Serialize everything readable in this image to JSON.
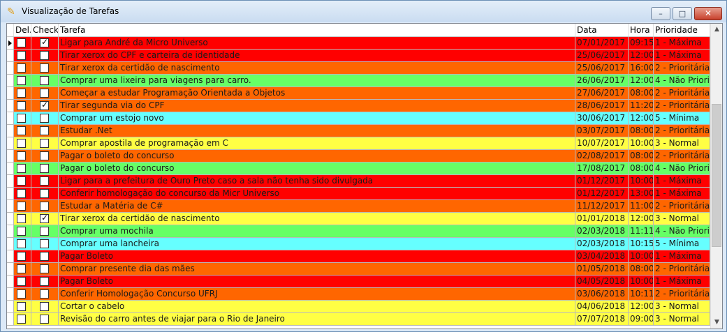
{
  "window": {
    "title": "Visualização de Tarefas",
    "app_icon": "app-icon",
    "buttons": {
      "minimize": "–",
      "maximize": "□",
      "close": "✕"
    }
  },
  "grid": {
    "columns": {
      "del": "Del.",
      "check": "Check",
      "tarefa": "Tarefa",
      "data": "Data",
      "hora": "Hora",
      "prioridade": "Prioridade"
    },
    "priority_colors": {
      "1 - Máxima": "#ff0000",
      "2 - Prioritária": "#ff6600",
      "3 - Normal": "#ffff44",
      "4 - Não Prioritária": "#66ff66",
      "5 - Mínima": "#66ffff"
    },
    "rows": [
      {
        "del": false,
        "check": true,
        "tarefa": "Ligar para André da Micro Universo",
        "data": "07/01/2017",
        "hora": "09:15",
        "prioridade": "1 - Máxima",
        "color": "#ff0000",
        "selected": true
      },
      {
        "del": false,
        "check": false,
        "tarefa": "Tirar xerox do CPF e carteira de identidade",
        "data": "25/06/2017",
        "hora": "12:00",
        "prioridade": "1 - Máxima",
        "color": "#ff0000"
      },
      {
        "del": false,
        "check": false,
        "tarefa": "Tirar xerox da certidão de nascimento",
        "data": "25/06/2017",
        "hora": "16:00",
        "prioridade": "2 - Prioritária",
        "color": "#ff6600"
      },
      {
        "del": false,
        "check": false,
        "tarefa": "Comprar uma lixeira para viagens para carro.",
        "data": "26/06/2017",
        "hora": "12:00",
        "prioridade": "4 - Não Priorit",
        "color": "#66ff66"
      },
      {
        "del": false,
        "check": false,
        "tarefa": "Começar a estudar Programação Orientada a Objetos",
        "data": "27/06/2017",
        "hora": "08:00",
        "prioridade": "2 - Prioritária",
        "color": "#ff6600"
      },
      {
        "del": false,
        "check": true,
        "tarefa": "Tirar segunda via do CPF",
        "data": "28/06/2017",
        "hora": "11:20",
        "prioridade": "2 - Prioritária",
        "color": "#ff6600"
      },
      {
        "del": false,
        "check": false,
        "tarefa": "Comprar um estojo novo",
        "data": "30/06/2017",
        "hora": "12:00",
        "prioridade": "5 - Mínima",
        "color": "#66ffff"
      },
      {
        "del": false,
        "check": false,
        "tarefa": "Estudar .Net",
        "data": "03/07/2017",
        "hora": "08:00",
        "prioridade": "2 - Prioritária",
        "color": "#ff6600"
      },
      {
        "del": false,
        "check": false,
        "tarefa": "Comprar apostila de programação em C",
        "data": "10/07/2017",
        "hora": "10:00",
        "prioridade": "3 - Normal",
        "color": "#ffff44"
      },
      {
        "del": false,
        "check": false,
        "tarefa": "Pagar o boleto do concurso",
        "data": "02/08/2017",
        "hora": "08:00",
        "prioridade": "2 - Prioritária",
        "color": "#ff6600"
      },
      {
        "del": false,
        "check": false,
        "tarefa": "Pagar o boleto do concurso",
        "data": "17/08/2017",
        "hora": "08:00",
        "prioridade": "4 - Não Priorit",
        "color": "#66ff66"
      },
      {
        "del": false,
        "check": false,
        "tarefa": "Ligar para a prefeitura de Ouro Preto caso a sala não tenha sido divulgada",
        "data": "01/12/2017",
        "hora": "10:00",
        "prioridade": "1 - Máxima",
        "color": "#ff0000"
      },
      {
        "del": false,
        "check": false,
        "tarefa": "Conferir homologação do concurso da Micr Universo",
        "data": "01/12/2017",
        "hora": "13:00",
        "prioridade": "1 - Máxima",
        "color": "#ff0000"
      },
      {
        "del": false,
        "check": false,
        "tarefa": "Estudar a Matéria de C#",
        "data": "11/12/2017",
        "hora": "11:00",
        "prioridade": "2 - Prioritária",
        "color": "#ff6600"
      },
      {
        "del": false,
        "check": true,
        "tarefa": "Tirar xerox da certidão de nascimento",
        "data": "01/01/2018",
        "hora": "12:00",
        "prioridade": "3 - Normal",
        "color": "#ffff44"
      },
      {
        "del": false,
        "check": false,
        "tarefa": "Comprar uma mochila",
        "data": "02/03/2018",
        "hora": "11:11",
        "prioridade": "4 - Não Priorit",
        "color": "#66ff66"
      },
      {
        "del": false,
        "check": false,
        "tarefa": "Comprar uma lancheira",
        "data": "02/03/2018",
        "hora": "10:15",
        "prioridade": "5 - Mínima",
        "color": "#66ffff"
      },
      {
        "del": false,
        "check": false,
        "tarefa": "Pagar Boleto",
        "data": "03/04/2018",
        "hora": "10:00",
        "prioridade": "1 - Máxima",
        "color": "#ff0000"
      },
      {
        "del": false,
        "check": false,
        "tarefa": "Comprar presente dia das mães",
        "data": "01/05/2018",
        "hora": "08:00",
        "prioridade": "2 - Prioritária",
        "color": "#ff6600"
      },
      {
        "del": false,
        "check": false,
        "tarefa": "Pagar Boleto",
        "data": "04/05/2018",
        "hora": "10:00",
        "prioridade": "1 - Máxima",
        "color": "#ff0000"
      },
      {
        "del": false,
        "check": false,
        "tarefa": "Conferir Homologação Concurso UFRJ",
        "data": "03/06/2018",
        "hora": "10:11",
        "prioridade": "2 - Prioritária",
        "color": "#ff6600"
      },
      {
        "del": false,
        "check": false,
        "tarefa": "Cortar o cabelo",
        "data": "04/06/2018",
        "hora": "12:00",
        "prioridade": "3 - Normal",
        "color": "#ffff44"
      },
      {
        "del": false,
        "check": false,
        "tarefa": "Revisão do carro antes de viajar para o Rio de Janeiro",
        "data": "07/07/2018",
        "hora": "09:00",
        "prioridade": "3 - Normal",
        "color": "#ffff44"
      }
    ]
  },
  "scrollbar": {
    "up": "▲",
    "down": "▼"
  }
}
